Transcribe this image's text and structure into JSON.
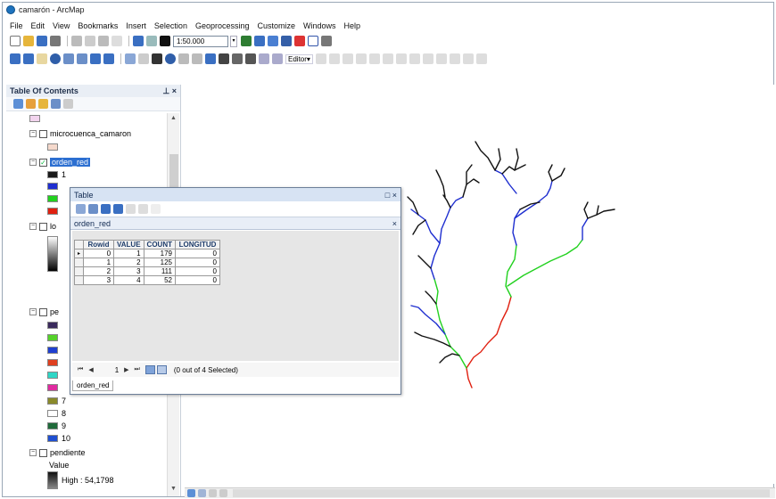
{
  "window": {
    "title": "camarón - ArcMap"
  },
  "menu": [
    "File",
    "Edit",
    "View",
    "Bookmarks",
    "Insert",
    "Selection",
    "Geoprocessing",
    "Customize",
    "Windows",
    "Help"
  ],
  "toolbar": {
    "scale": "1:50.000",
    "editor_label": "Editor▾"
  },
  "toc": {
    "title": "Table Of Contents",
    "pin": "⊥ ×",
    "items": {
      "microcuenca": "microcuenca_camaron",
      "orden_red": "orden_red",
      "orden_1": "1",
      "lo_partial": "lo",
      "pe_partial": "pe",
      "c7": "7",
      "c8": "8",
      "c9": "9",
      "c10": "10",
      "pendiente": "pendiente",
      "value_label": "Value",
      "high_label": "High : 54,1798"
    }
  },
  "table_window": {
    "title": "Table",
    "tab": "orden_red",
    "columns": [
      "Rowid",
      "VALUE",
      "COUNT",
      "LONGITUD"
    ],
    "rows": [
      [
        "0",
        "1",
        "179",
        "0"
      ],
      [
        "1",
        "2",
        "125",
        "0"
      ],
      [
        "2",
        "3",
        "111",
        "0"
      ],
      [
        "3",
        "4",
        "52",
        "0"
      ]
    ],
    "current_record": "1",
    "selection_status": "(0 out of 4 Selected)",
    "footer_tab": "orden_red"
  },
  "colors": {
    "order1": "#1a1a1a",
    "order2": "#1f2fd0",
    "order3": "#22d11f",
    "order4": "#e02010"
  }
}
